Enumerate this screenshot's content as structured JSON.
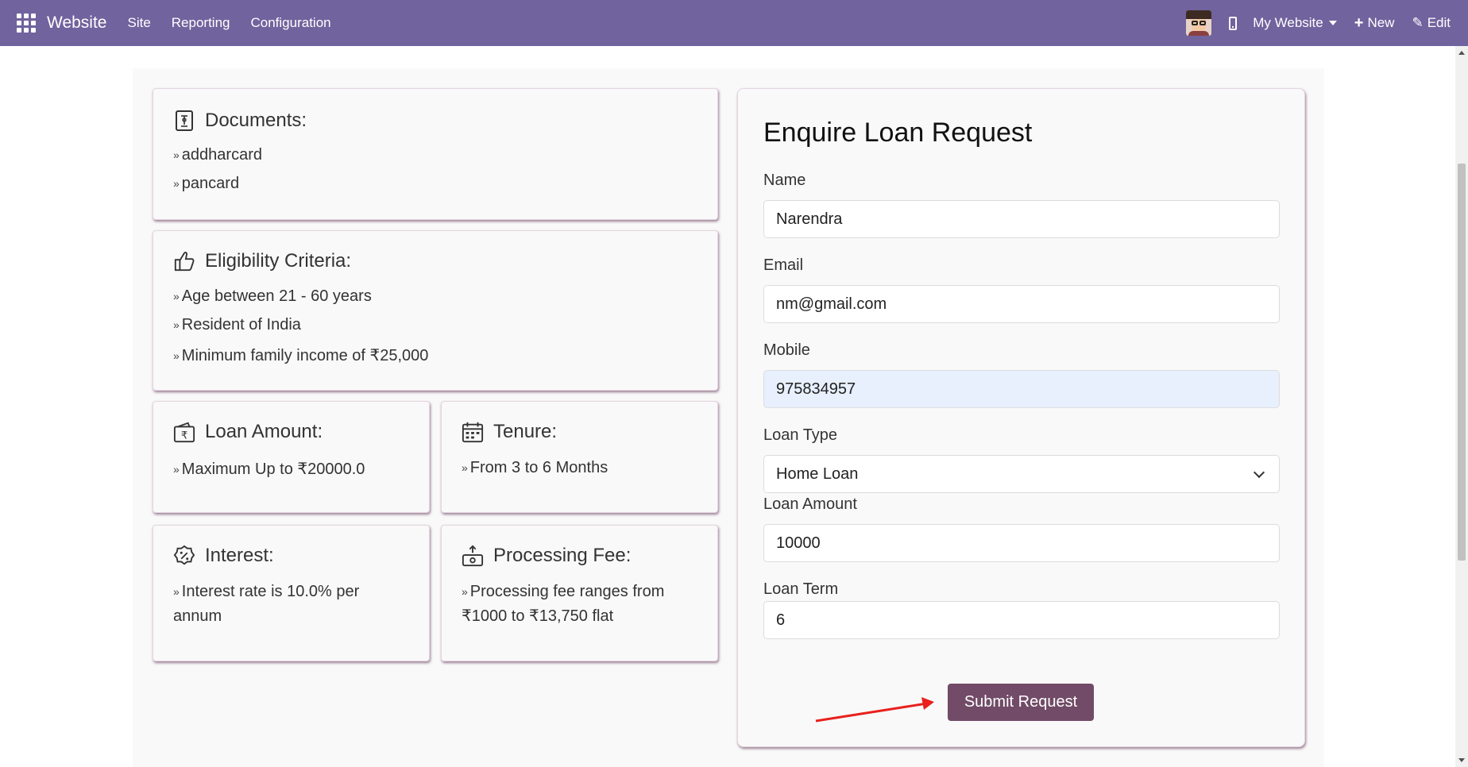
{
  "navbar": {
    "brand": "Website",
    "menu": [
      "Site",
      "Reporting",
      "Configuration"
    ],
    "website_selector": "My Website",
    "new_label": "New",
    "edit_label": "Edit",
    "bg_color": "#71639e"
  },
  "cards": {
    "documents": {
      "title": "Documents:",
      "items": [
        "addharcard",
        "pancard"
      ]
    },
    "eligibility": {
      "title": "Eligibility Criteria:",
      "items": [
        "Age between 21 - 60 years",
        "Resident of India",
        "Minimum family income of ₹25,000"
      ]
    },
    "loan_amount": {
      "title": "Loan Amount:",
      "text": "Maximum Up to ₹20000.0"
    },
    "tenure": {
      "title": "Tenure:",
      "text": "From 3 to 6 Months"
    },
    "interest": {
      "title": "Interest:",
      "text": "Interest rate is 10.0% per annum"
    },
    "processing_fee": {
      "title": "Processing Fee:",
      "text": "Processing fee ranges from ₹1000 to ₹13,750 flat"
    }
  },
  "form": {
    "title": "Enquire Loan Request",
    "name_label": "Name",
    "name_value": "Narendra",
    "email_label": "Email",
    "email_value": "nm@gmail.com",
    "mobile_label": "Mobile",
    "mobile_value": "975834957",
    "loan_type_label": "Loan Type",
    "loan_type_value": "Home Loan",
    "loan_amount_label": "Loan Amount",
    "loan_amount_value": "10000",
    "loan_term_label": "Loan Term",
    "loan_term_value": "6",
    "submit_label": "Submit Request",
    "accent_color": "#714b67"
  }
}
